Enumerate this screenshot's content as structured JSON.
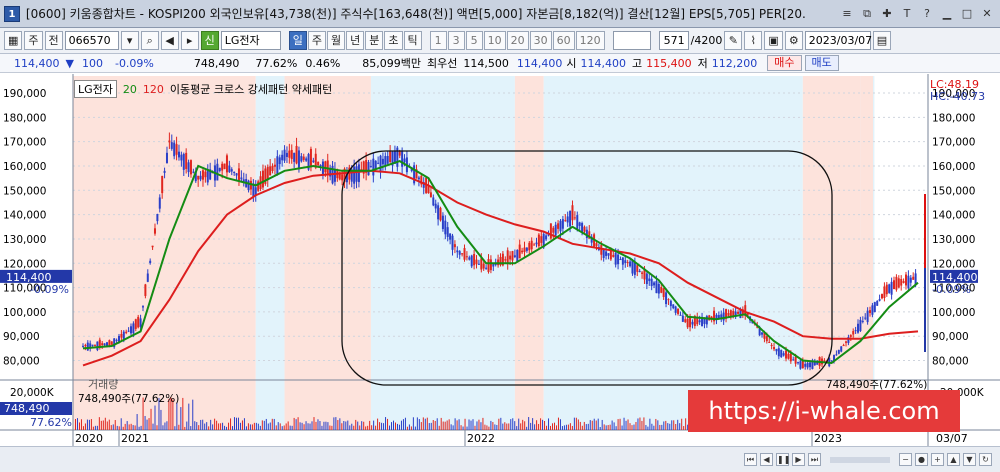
{
  "window": {
    "number": "1",
    "title": "[0600] 키움종합차트 - KOSPI200 외국인보유[43,738(천)] 주식수[163,648(천)] 액면[5,000] 자본금[8,182(억)] 결산[12월] EPS[5,705] PER[20.",
    "icons": [
      "menu-icon",
      "restore-icon",
      "pin-icon",
      "text-icon",
      "help-icon",
      "minimize-icon",
      "maximize-icon",
      "close-icon"
    ],
    "icon_glyphs": [
      "≡",
      "⧉",
      "✚",
      "T",
      "?",
      "▁",
      "□",
      "✕"
    ]
  },
  "toolbar": {
    "mode": "주",
    "prev_label": "전",
    "code": "066570",
    "stock_badge": "신",
    "stock_name": "LG전자",
    "period_tabs": [
      "일",
      "주",
      "월",
      "년",
      "분",
      "초",
      "틱"
    ],
    "active_period": "일",
    "minute_options": [
      "1",
      "3",
      "5",
      "10",
      "20",
      "30",
      "60",
      "120"
    ],
    "count": "571",
    "count_total": "/4200",
    "date": "2023/03/07"
  },
  "info": {
    "price": "114,400",
    "change": "100",
    "change_pct": "-0.09%",
    "volume": "748,490",
    "vol_ratio": "77.62%",
    "turnover": "0.46%",
    "amount": "85,099백만",
    "best_ask_label": "최우선",
    "best_ask": "114,500",
    "bid": "114,400",
    "open_label": "시",
    "open": "114,400",
    "high_label": "고",
    "high": "115,400",
    "low_label": "저",
    "low": "112,200",
    "buy_label": "매수",
    "sell_label": "매도"
  },
  "legend": {
    "name": "LG전자",
    "ma_short": "20",
    "ma_long": "120",
    "desc": "이동평균 크로스 강세패턴  약세패턴"
  },
  "right_labels": {
    "lc": "LC:48.19",
    "hc": "HC:-40.73",
    "current": "114,400",
    "current_pct": "-0.09%",
    "volume_label": "748,490주(77.62%)",
    "vol_current": "748,490",
    "vol_pct": "77.62%"
  },
  "volume_panel": {
    "title": "거래량",
    "value": "748,490주(77.62%)",
    "axis_top": "20,000K"
  },
  "x_labels": [
    "2020",
    "2021",
    "2022",
    "2023"
  ],
  "x_end_label": "03/07",
  "watermark": "https://i-whale.com",
  "colors": {
    "bull_bg": "#fde3dc",
    "bear_bg": "#e2f3fb",
    "candle_up": "#e0261f",
    "candle_down": "#2a3fc8",
    "ma20": "#148c14",
    "ma120": "#dd1e1e"
  },
  "chart_data": {
    "type": "line",
    "title": "",
    "xlabel": "",
    "ylabel": "",
    "y_ticks": [
      80000,
      90000,
      100000,
      110000,
      120000,
      130000,
      140000,
      150000,
      160000,
      170000,
      180000,
      190000
    ],
    "y_tick_labels": [
      "80,000",
      "90,000",
      "100,000",
      "110,000",
      "120,000",
      "130,000",
      "140,000",
      "150,000",
      "160,000",
      "170,000",
      "180,000",
      "190,000"
    ],
    "ylim": [
      72000,
      197000
    ],
    "x": [
      "2020-10",
      "2020-11",
      "2020-12",
      "2021-01",
      "2021-02",
      "2021-03",
      "2021-04",
      "2021-05",
      "2021-06",
      "2021-07",
      "2021-08",
      "2021-09",
      "2021-10",
      "2021-11",
      "2021-12",
      "2022-01",
      "2022-02",
      "2022-03",
      "2022-04",
      "2022-05",
      "2022-06",
      "2022-07",
      "2022-08",
      "2022-09",
      "2022-10",
      "2022-11",
      "2022-12",
      "2023-01",
      "2023-02",
      "2023-03"
    ],
    "series": [
      {
        "name": "LG전자",
        "values": [
          86000,
          87000,
          96000,
          170000,
          155000,
          160000,
          150000,
          165000,
          162000,
          155000,
          160000,
          165000,
          150000,
          125000,
          118000,
          123000,
          130000,
          140000,
          125000,
          120000,
          110000,
          95000,
          98000,
          100000,
          85000,
          78000,
          80000,
          95000,
          110000,
          114400
        ]
      },
      {
        "name": "20",
        "values": [
          85000,
          86000,
          92000,
          130000,
          160000,
          155000,
          152000,
          158000,
          160000,
          158000,
          158000,
          162000,
          155000,
          135000,
          120000,
          120000,
          127000,
          135000,
          128000,
          122000,
          113000,
          98000,
          97000,
          99000,
          88000,
          80000,
          79000,
          88000,
          102000,
          112000
        ]
      },
      {
        "name": "120",
        "values": [
          78000,
          82000,
          88000,
          105000,
          125000,
          140000,
          148000,
          153000,
          156000,
          157000,
          158000,
          157000,
          152000,
          145000,
          140000,
          136000,
          133000,
          128000,
          126000,
          124000,
          120000,
          112000,
          106000,
          100000,
          96000,
          90000,
          89000,
          89000,
          91000,
          92000
        ]
      }
    ],
    "shading": [
      {
        "from": "2020-10",
        "to": "2021-04",
        "kind": "bull"
      },
      {
        "from": "2021-04",
        "to": "2021-05",
        "kind": "bear"
      },
      {
        "from": "2021-05",
        "to": "2021-08",
        "kind": "bull"
      },
      {
        "from": "2021-08",
        "to": "2022-01",
        "kind": "bear"
      },
      {
        "from": "2022-01",
        "to": "2022-02",
        "kind": "bull"
      },
      {
        "from": "2022-02",
        "to": "2022-11",
        "kind": "bear"
      },
      {
        "from": "2022-11",
        "to": "2023-01",
        "kind": "bull"
      },
      {
        "from": "2023-01",
        "to": "2023-01",
        "kind": "bear"
      },
      {
        "from": "2023-01",
        "to": "2023-03",
        "kind": "bull"
      }
    ],
    "grid": true
  }
}
